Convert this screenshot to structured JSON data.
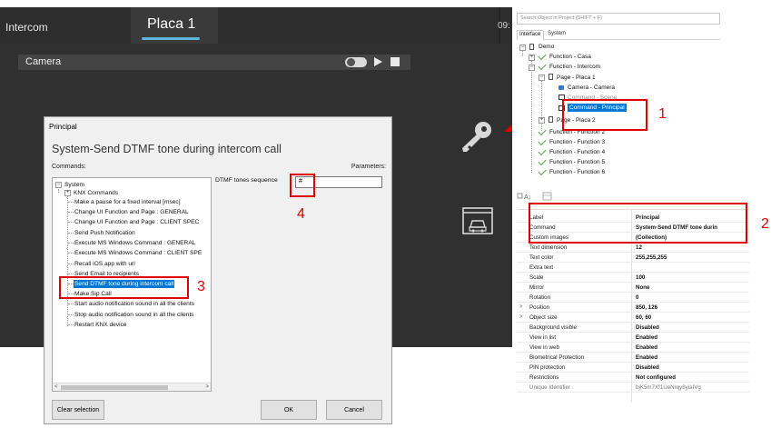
{
  "app": {
    "tabs": [
      {
        "label": "Intercom"
      },
      {
        "label": "Placa 1"
      }
    ],
    "time_fragment": "09:",
    "camera_label": "Camera"
  },
  "dialog": {
    "title": "Principal",
    "heading": "System-Send DTMF tone during intercom call",
    "commands_label": "Commands:",
    "parameters_label": "Parameters:",
    "tree": [
      {
        "label": "System"
      },
      {
        "label": "KNX Commands"
      },
      {
        "label": "Make a pause for a fixed interval [msec]"
      },
      {
        "label": "Change UI Function and Page : GENERAL"
      },
      {
        "label": "Change UI Function and Page : CLIENT SPEC"
      },
      {
        "label": "Send Push Notification"
      },
      {
        "label": "Execute MS Windows Command : GENERAL"
      },
      {
        "label": "Execute MS Windows Command : CLIENT SPE"
      },
      {
        "label": "Recall iOS app with url"
      },
      {
        "label": "Send Email to recipients"
      },
      {
        "label": "Send DTMF tone during intercom call"
      },
      {
        "label": "Make Sip Call"
      },
      {
        "label": "Start audio notification sound in all the clients"
      },
      {
        "label": "Stop audio notification sound in all the clients"
      },
      {
        "label": "Restart KNX device"
      }
    ],
    "dtmf_label": "DTMF tones sequence",
    "dtmf_value": "#",
    "buttons": {
      "clear": "Clear selection",
      "ok": "OK",
      "cancel": "Cancel"
    }
  },
  "annotations": {
    "n1": "1",
    "n2": "2",
    "n3": "3",
    "n4": "4",
    "color": "#e00000"
  },
  "right_panel": {
    "search_placeholder": "Search Object in Project (SHIFT + F)",
    "tabs": [
      "Interface",
      "System"
    ],
    "tree": [
      {
        "label": "Demo"
      },
      {
        "label": "Function - Casa"
      },
      {
        "label": "Function - Intercom"
      },
      {
        "label": "Page - Placa 1"
      },
      {
        "label": "Camera - Camera"
      },
      {
        "label": "Command - Scene"
      },
      {
        "label": "Command - Principal"
      },
      {
        "label": "Page - Placa 2"
      },
      {
        "label": "Function - Function 2"
      },
      {
        "label": "Function - Function 3"
      },
      {
        "label": "Function - Function 4"
      },
      {
        "label": "Function - Function 5"
      },
      {
        "label": "Function - Function 6"
      }
    ],
    "properties": [
      {
        "name": "Label",
        "value": "Principal"
      },
      {
        "name": "Command",
        "value": "System-Send DTMF tone durin"
      },
      {
        "name": "Custom images",
        "value": "(Collection)"
      },
      {
        "name": "Text dimension",
        "value": "12"
      },
      {
        "name": "Text color",
        "value": "255,255,255"
      },
      {
        "name": "Extra text",
        "value": ""
      },
      {
        "name": "Scale",
        "value": "100"
      },
      {
        "name": "Mirror",
        "value": "None"
      },
      {
        "name": "Rotation",
        "value": "0"
      },
      {
        "name": "Position",
        "value": "850, 126"
      },
      {
        "name": "Object size",
        "value": "60, 60"
      },
      {
        "name": "Background visible",
        "value": "Disabled"
      },
      {
        "name": "View in list",
        "value": "Enabled"
      },
      {
        "name": "View in web",
        "value": "Enabled"
      },
      {
        "name": "Biometrical Protection",
        "value": "Enabled"
      },
      {
        "name": "PIN protection",
        "value": "Disabled"
      },
      {
        "name": "Restrictions",
        "value": "Not configured"
      },
      {
        "name": "Unique Identifier",
        "value": "bjK5m7Xf1UeNrqy8yiaIVg"
      }
    ]
  },
  "colors": {
    "selection": "#0078d7",
    "tab_underline": "#5fb4d9",
    "check": "#5aa14e"
  }
}
